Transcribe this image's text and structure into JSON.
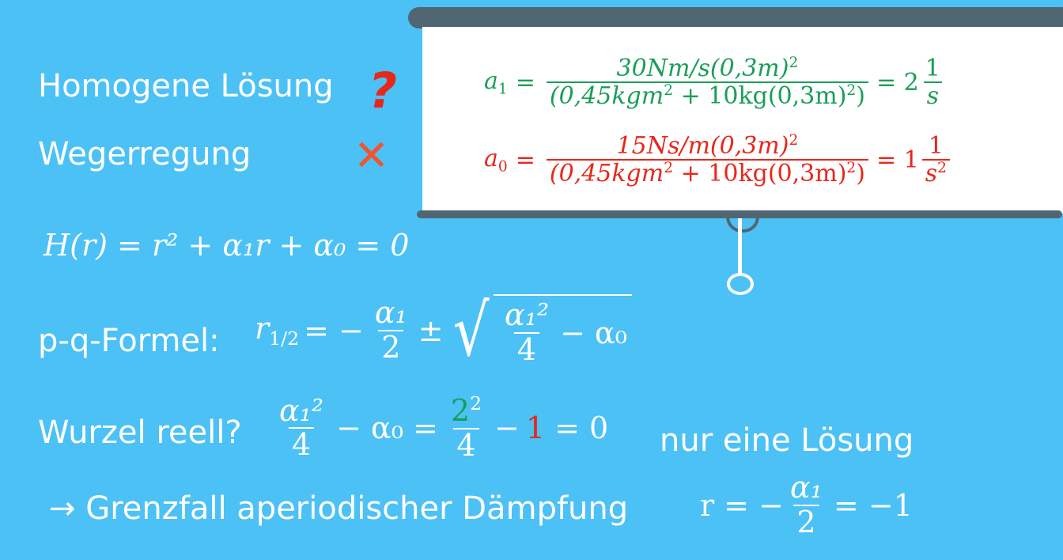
{
  "labels": {
    "homogene": "Homogene Lösung",
    "wegerregung": "Wegerregung",
    "pq": "p-q-Formel:",
    "wurzel": "Wurzel reell?",
    "nur_eine": "nur eine Lösung",
    "grenzfall": "→ Grenzfall aperiodischer Dämpfung"
  },
  "icons": {
    "question": "?",
    "cross": "✕",
    "question_icon_name": "question-mark-icon",
    "cross_icon_name": "cross-icon"
  },
  "screen": {
    "alpha1_lhs": "a",
    "alpha1_sub": "1",
    "alpha1_num": "30Nm/s(0,3m)",
    "alpha1_num_sup": "2",
    "alpha1_den_a": "(0,45kgm",
    "alpha1_den_sup1": "2",
    "alpha1_den_b": " + 10kg(0,3m)",
    "alpha1_den_sup2": "2",
    "alpha1_den_c": ")",
    "alpha1_result": "= 2",
    "alpha1_unit_num": "1",
    "alpha1_unit_den": "s",
    "alpha0_lhs": "a",
    "alpha0_sub": "0",
    "alpha0_num": "15Ns/m(0,3m)",
    "alpha0_num_sup": "2",
    "alpha0_den_a": "(0,45kgm",
    "alpha0_den_sup1": "2",
    "alpha0_den_b": " + 10kg(0,3m)",
    "alpha0_den_sup2": "2",
    "alpha0_den_c": ")",
    "alpha0_result": "= 1",
    "alpha0_unit_num": "1",
    "alpha0_unit_den": "s",
    "alpha0_unit_den_sup": "2"
  },
  "equations": {
    "char_poly": "H(r) = r² + α₁r + α₀ = 0",
    "pq_lhs": "r",
    "pq_lhs_sub": "1/2",
    "pq_eq": "= −",
    "pq_frac_num": "α₁",
    "pq_frac_den": "2",
    "pq_pm": "±",
    "pq_sqrt_num": "α₁²",
    "pq_sqrt_den": "4",
    "pq_sqrt_tail": "− α₀",
    "wurzel_frac_num": "α₁²",
    "wurzel_frac_den": "4",
    "wurzel_mid": "− α₀ =",
    "wurzel_num_green": "2",
    "wurzel_num_sup": "2",
    "wurzel_den": "4",
    "wurzel_minus": "−",
    "wurzel_red": "1",
    "wurzel_tail": "= 0",
    "grenz_lhs": "r = −",
    "grenz_frac_num": "α₁",
    "grenz_frac_den": "2",
    "grenz_tail": "= −1"
  },
  "colors": {
    "background": "#4cc1f5",
    "screen_frame": "#506672",
    "green": "#1a9e58",
    "red": "#e8271b"
  }
}
